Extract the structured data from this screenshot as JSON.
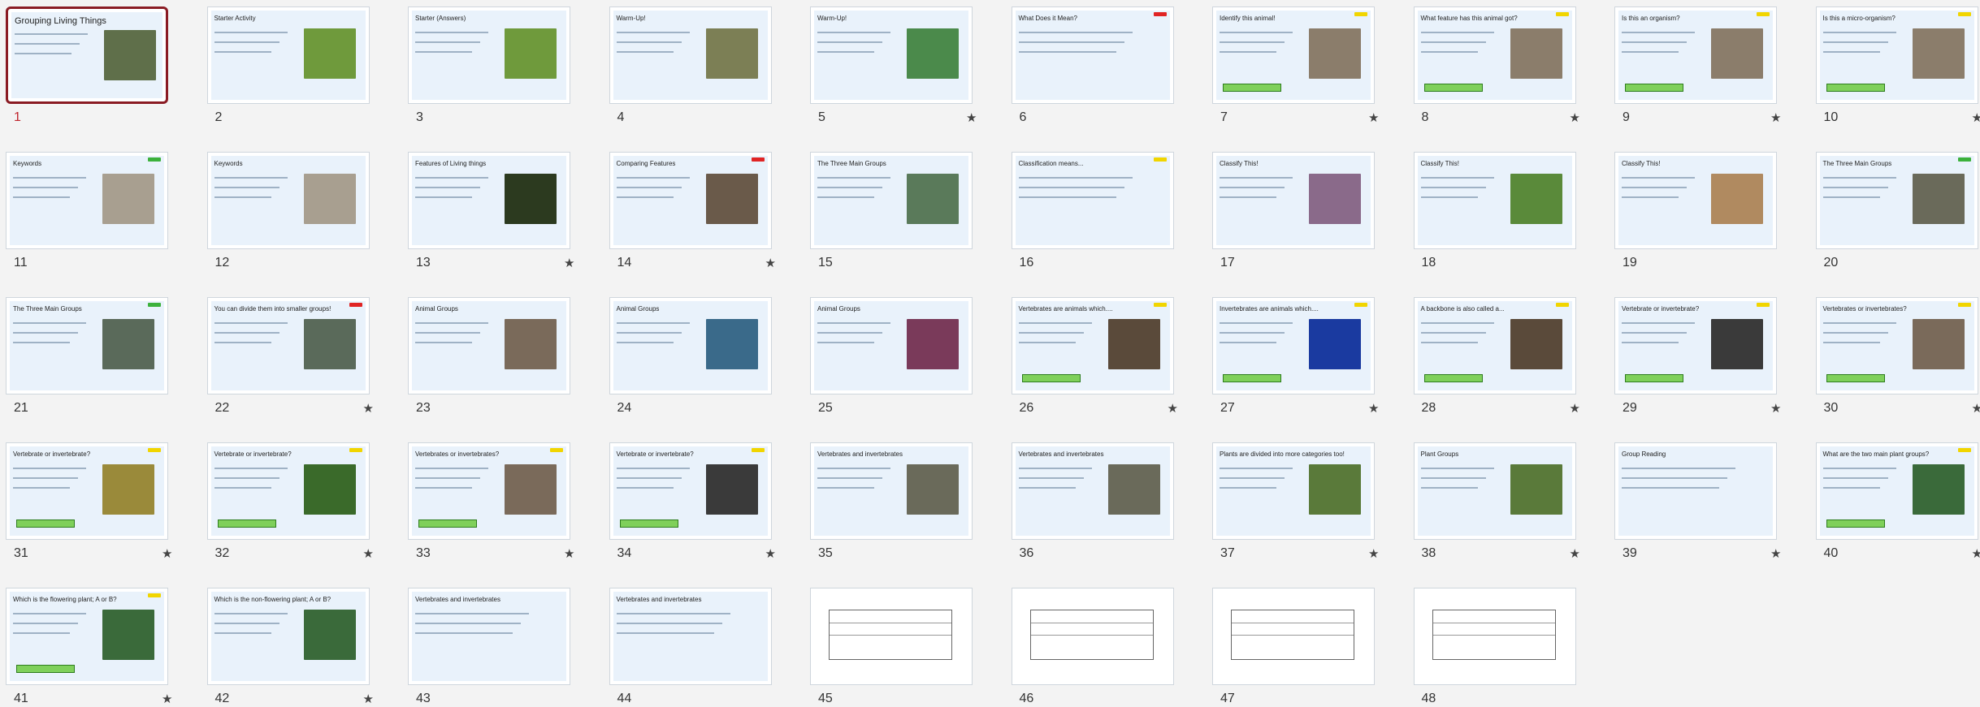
{
  "selected_slide": 1,
  "colors": {
    "selection": "#8a1b23",
    "slide_bg": "#e9f2fb",
    "badge_red": "#e02424",
    "badge_green": "#3cb13c",
    "badge_yellow": "#f1d500",
    "answer_green": "#7fd05a"
  },
  "slides": [
    {
      "number": "1",
      "title": "Grouping Living Things",
      "star": false,
      "badge": "",
      "img": "#5f6f4a"
    },
    {
      "number": "2",
      "title": "Starter Activity",
      "star": false,
      "badge": "",
      "img": "#6f9a3c"
    },
    {
      "number": "3",
      "title": "Starter (Answers)",
      "star": false,
      "badge": "",
      "img": "#6f9a3c"
    },
    {
      "number": "4",
      "title": "Warm-Up!",
      "star": false,
      "badge": "",
      "img": "#7c7f55"
    },
    {
      "number": "5",
      "title": "Warm-Up!",
      "star": true,
      "badge": "",
      "img": "#4b8a4b"
    },
    {
      "number": "6",
      "title": "What Does it Mean?",
      "star": false,
      "badge": "red",
      "img": ""
    },
    {
      "number": "7",
      "title": "Identify this animal!",
      "star": true,
      "badge": "yellow",
      "img": "#8b7d6b"
    },
    {
      "number": "8",
      "title": "What feature has this animal got?",
      "star": true,
      "badge": "yellow",
      "img": "#8b7d6b"
    },
    {
      "number": "9",
      "title": "Is this an organism?",
      "star": true,
      "badge": "yellow",
      "img": "#8b7d6b"
    },
    {
      "number": "10",
      "title": "Is this a micro-organism?",
      "star": true,
      "badge": "yellow",
      "img": "#8b7d6b"
    },
    {
      "number": "11",
      "title": "Keywords",
      "star": false,
      "badge": "green",
      "img": "#a89f90"
    },
    {
      "number": "12",
      "title": "Keywords",
      "star": false,
      "badge": "",
      "img": "#a89f90"
    },
    {
      "number": "13",
      "title": "Features of Living things",
      "star": true,
      "badge": "",
      "img": "#2c3a1f"
    },
    {
      "number": "14",
      "title": "Comparing Features",
      "star": true,
      "badge": "red",
      "img": "#6a5a4a"
    },
    {
      "number": "15",
      "title": "The Three Main Groups",
      "star": false,
      "badge": "",
      "img": "#5a7a5a"
    },
    {
      "number": "16",
      "title": "Classification means...",
      "star": false,
      "badge": "yellow",
      "img": ""
    },
    {
      "number": "17",
      "title": "Classify This!",
      "star": false,
      "badge": "",
      "img": "#8a6a8a"
    },
    {
      "number": "18",
      "title": "Classify This!",
      "star": false,
      "badge": "",
      "img": "#5a8a3a"
    },
    {
      "number": "19",
      "title": "Classify This!",
      "star": false,
      "badge": "",
      "img": "#b08a60"
    },
    {
      "number": "20",
      "title": "The Three Main Groups",
      "star": false,
      "badge": "green",
      "img": "#6a6a5a"
    },
    {
      "number": "21",
      "title": "The Three Main Groups",
      "star": false,
      "badge": "green",
      "img": "#5a6a5a"
    },
    {
      "number": "22",
      "title": "You can divide them into smaller groups!",
      "star": true,
      "badge": "red",
      "img": "#5a6a5a"
    },
    {
      "number": "23",
      "title": "Animal Groups",
      "star": false,
      "badge": "",
      "img": "#7a6a5a"
    },
    {
      "number": "24",
      "title": "Animal Groups",
      "star": false,
      "badge": "",
      "img": "#3a6a8a"
    },
    {
      "number": "25",
      "title": "Animal Groups",
      "star": false,
      "badge": "",
      "img": "#7a3a5a"
    },
    {
      "number": "26",
      "title": "Vertebrates are animals which....",
      "star": true,
      "badge": "yellow",
      "img": "#5a4a3a"
    },
    {
      "number": "27",
      "title": "Invertebrates are animals which....",
      "star": true,
      "badge": "yellow",
      "img": "#1a3aa0"
    },
    {
      "number": "28",
      "title": "A backbone is also called a...",
      "star": true,
      "badge": "yellow",
      "img": "#5a4a3a"
    },
    {
      "number": "29",
      "title": "Vertebrate or invertebrate?",
      "star": true,
      "badge": "yellow",
      "img": "#3a3a3a"
    },
    {
      "number": "30",
      "title": "Vertebrates or invertebrates?",
      "star": true,
      "badge": "yellow",
      "img": "#7a6a5a"
    },
    {
      "number": "31",
      "title": "Vertebrate or invertebrate?",
      "star": true,
      "badge": "yellow",
      "img": "#9a8a3a"
    },
    {
      "number": "32",
      "title": "Vertebrate or invertebrate?",
      "star": true,
      "badge": "yellow",
      "img": "#3a6a2a"
    },
    {
      "number": "33",
      "title": "Vertebrates or invertebrates?",
      "star": true,
      "badge": "yellow",
      "img": "#7a6a5a"
    },
    {
      "number": "34",
      "title": "Vertebrate or invertebrate?",
      "star": true,
      "badge": "yellow",
      "img": "#3a3a3a"
    },
    {
      "number": "35",
      "title": "Vertebrates and invertebrates",
      "star": false,
      "badge": "",
      "img": "#6a6a5a"
    },
    {
      "number": "36",
      "title": "Vertebrates and invertebrates",
      "star": false,
      "badge": "",
      "img": "#6a6a5a"
    },
    {
      "number": "37",
      "title": "Plants are divided into more categories too!",
      "star": true,
      "badge": "",
      "img": "#5a7a3a"
    },
    {
      "number": "38",
      "title": "Plant Groups",
      "star": true,
      "badge": "",
      "img": "#5a7a3a"
    },
    {
      "number": "39",
      "title": "Group Reading",
      "star": true,
      "badge": "",
      "img": ""
    },
    {
      "number": "40",
      "title": "What are the two main plant groups?",
      "star": true,
      "badge": "yellow",
      "img": "#3a6a3a"
    },
    {
      "number": "41",
      "title": "Which is the flowering plant; A or B?",
      "star": true,
      "badge": "yellow",
      "img": "#3a6a3a"
    },
    {
      "number": "42",
      "title": "Which is the non-flowering plant; A or B?",
      "star": true,
      "badge": "",
      "img": "#3a6a3a"
    },
    {
      "number": "43",
      "title": "Vertebrates and invertebrates",
      "star": false,
      "badge": "",
      "img": ""
    },
    {
      "number": "44",
      "title": "Vertebrates and invertebrates",
      "star": false,
      "badge": "",
      "img": ""
    },
    {
      "number": "45",
      "title": "",
      "star": false,
      "badge": "",
      "img": "",
      "doc": true
    },
    {
      "number": "46",
      "title": "",
      "star": false,
      "badge": "",
      "img": "",
      "doc": true
    },
    {
      "number": "47",
      "title": "",
      "star": false,
      "badge": "",
      "img": "",
      "doc": true
    },
    {
      "number": "48",
      "title": "",
      "star": false,
      "badge": "",
      "img": "",
      "doc": true
    }
  ]
}
